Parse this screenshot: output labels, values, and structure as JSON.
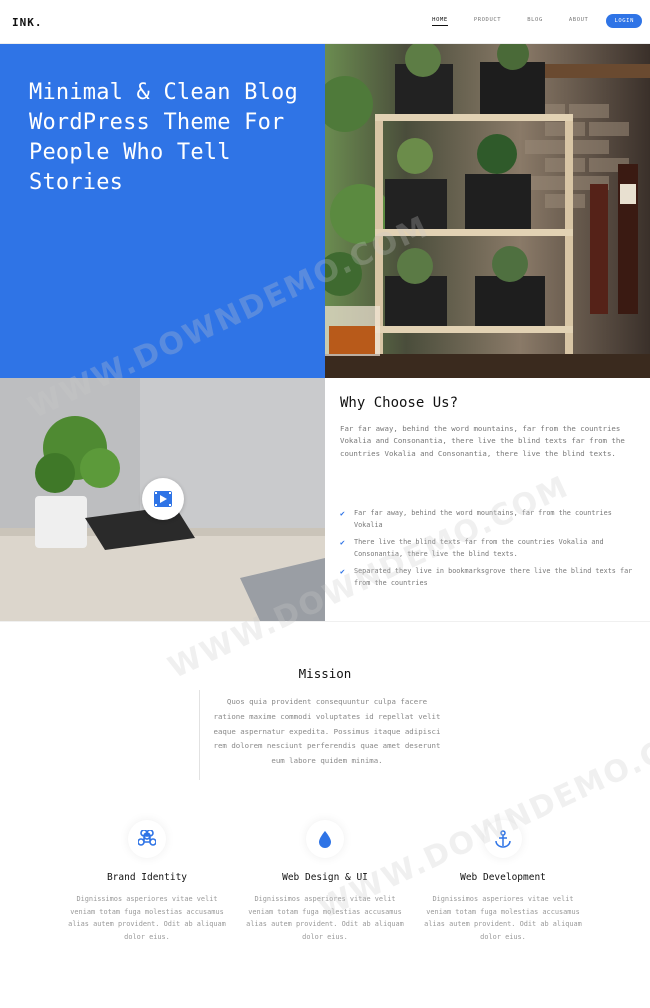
{
  "header": {
    "logo": "INK.",
    "nav": [
      {
        "label": "HOME"
      },
      {
        "label": "PRODUCT"
      },
      {
        "label": "BLOG"
      },
      {
        "label": "ABOUT"
      }
    ],
    "login_label": "LOGIN"
  },
  "hero": {
    "title": "Minimal & Clean Blog WordPress Theme For People Who Tell Stories"
  },
  "why": {
    "title": "Why Choose Us?",
    "text": "Far far away, behind the word mountains, far from the countries Vokalia and Consonantia, there live the blind texts far from the countries Vokalia and Consonantia, there live the blind texts.",
    "items": [
      "Far far away, behind the word mountains, far from the countries Vokalia",
      "There live the blind texts far from the countries Vokalia and Consonantia, there live the blind texts.",
      "Separated they live in bookmarksgrove there live the blind texts far from the countries"
    ]
  },
  "mission": {
    "title": "Mission",
    "text": "Quos quia provident consequuntur culpa facere ratione maxime commodi voluptates id repellat velit eaque aspernatur expedita. Possimus itaque adipisci rem dolorem nesciunt perferendis quae amet deserunt eum labore quidem minima."
  },
  "features": [
    {
      "title": "Brand Identity",
      "text": "Dignissimos asperiores vitae velit veniam totam fuga molestias accusamus alias autem provident. Odit ab aliquam dolor eius.",
      "icon": "command-icon"
    },
    {
      "title": "Web Design & UI",
      "text": "Dignissimos asperiores vitae velit veniam totam fuga molestias accusamus alias autem provident. Odit ab aliquam dolor eius.",
      "icon": "drop-icon"
    },
    {
      "title": "Web Development",
      "text": "Dignissimos asperiores vitae velit veniam totam fuga molestias accusamus alias autem provident. Odit ab aliquam dolor eius.",
      "icon": "anchor-icon"
    }
  ],
  "watermark": "WWW.DOWNDEMO.COM",
  "colors": {
    "accent": "#2f74e6"
  }
}
